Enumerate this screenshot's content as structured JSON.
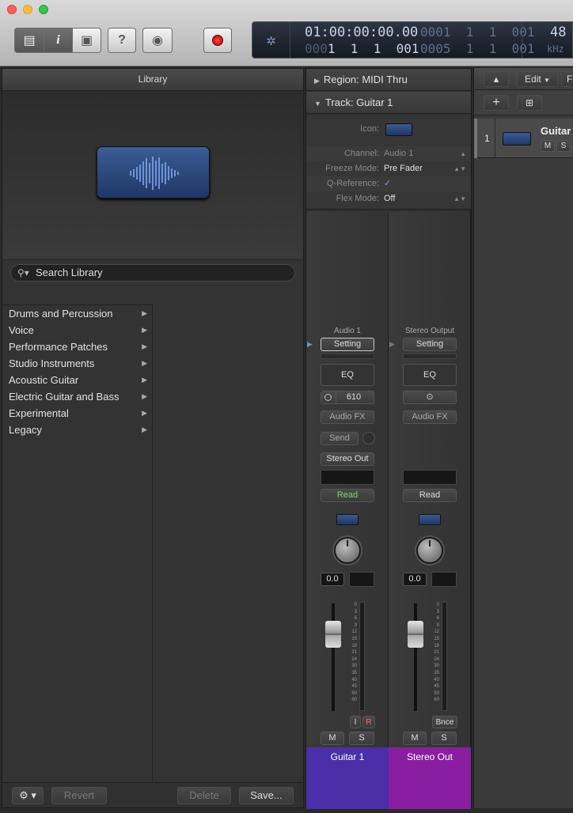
{
  "toolbar": {
    "lcd": {
      "time_top": "01:00:00:00.00",
      "time_bottom_dim": "000",
      "time_bottom": "1  1  1  001",
      "bar_top": "0001  1  1  001",
      "bar_bottom": "0005  1  1  001",
      "rate_value": "48",
      "rate_unit": "kHz"
    },
    "gear_icon": "gear-icon"
  },
  "library": {
    "title": "Library",
    "search_placeholder": "Search Library",
    "items": [
      {
        "label": "Drums and Percussion"
      },
      {
        "label": "Voice"
      },
      {
        "label": "Performance Patches"
      },
      {
        "label": "Studio Instruments"
      },
      {
        "label": "Acoustic Guitar"
      },
      {
        "label": "Electric Guitar and Bass"
      },
      {
        "label": "Experimental"
      },
      {
        "label": "Legacy"
      }
    ],
    "buttons": {
      "gear": "⚙ ▾",
      "revert": "Revert",
      "delete": "Delete",
      "save": "Save..."
    }
  },
  "inspector": {
    "region_label": "Region:  MIDI Thru",
    "track_label": "Track:  Guitar 1",
    "params": [
      {
        "key": "Icon:",
        "value": ""
      },
      {
        "key": "Channel:",
        "value": "Audio 1"
      },
      {
        "key": "Freeze Mode:",
        "value": "Pre Fader"
      },
      {
        "key": "Q-Reference:",
        "value": "✓"
      },
      {
        "key": "Flex Mode:",
        "value": "Off"
      }
    ]
  },
  "strips": [
    {
      "label": "Audio 1",
      "setting": "Setting",
      "eq": "EQ",
      "input": "610",
      "audio_fx": "Audio FX",
      "send": "Send",
      "output": "Stereo Out",
      "automation": "Read",
      "pan_value": "0.0",
      "buttons": {
        "i": "I",
        "r": "R",
        "m": "M",
        "s": "S"
      },
      "name": "Guitar 1",
      "color": "#4a2fa8"
    },
    {
      "label": "Stereo Output",
      "setting": "Setting",
      "eq": "EQ",
      "input": "",
      "audio_fx": "Audio FX",
      "output": "",
      "automation": "Read",
      "pan_value": "0.0",
      "buttons": {
        "bnce": "Bnce",
        "m": "M",
        "s": "S"
      },
      "name": "Stereo Out",
      "color": "#8a1ea0"
    }
  ],
  "meter_scale": [
    "0",
    "3",
    "6",
    "9",
    "12",
    "15",
    "18",
    "21",
    "24",
    "30",
    "35",
    "40",
    "45",
    "50",
    "60"
  ],
  "tracks": {
    "edit_label": "Edit",
    "f_label": "F",
    "track_number": "1",
    "track_name": "Guitar",
    "m": "M",
    "s": "S"
  },
  "colors": {
    "accent_blue": "#3b5c96",
    "record_red": "#d22",
    "read_green": "#7fd36a"
  }
}
